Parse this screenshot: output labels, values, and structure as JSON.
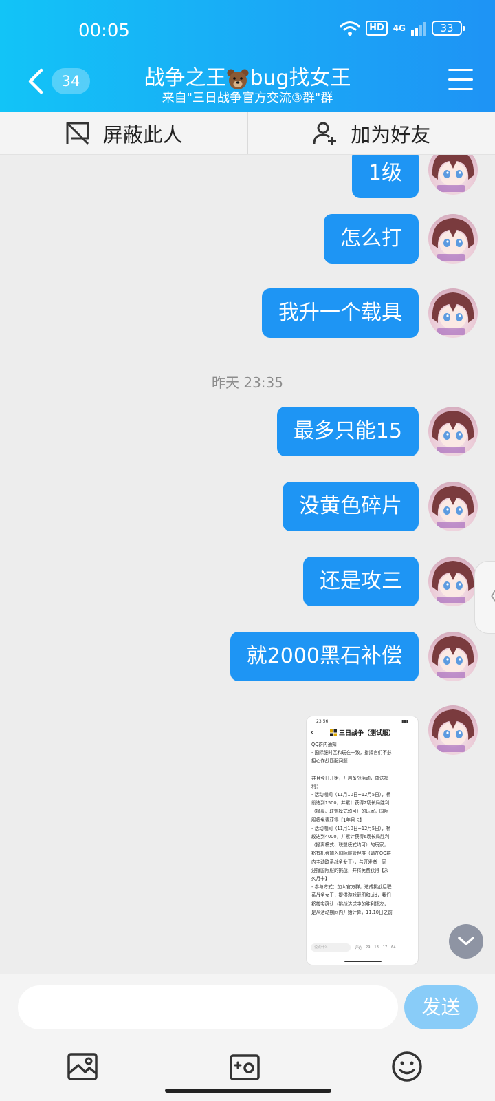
{
  "status_bar": {
    "time": "00:05",
    "hd": "HD",
    "network": "4G",
    "battery": "33"
  },
  "header": {
    "unread_count": "34",
    "title_part1": "战争之王",
    "title_part2": "bug找女王",
    "subtitle": "来自\"三日战争官方交流③群\"群"
  },
  "actions": {
    "block": "屏蔽此人",
    "add_friend": "加为好友"
  },
  "messages": [
    {
      "text": "1级"
    },
    {
      "text": "怎么打"
    },
    {
      "text": "我升一个载具"
    },
    {
      "text": "最多只能15"
    },
    {
      "text": "没黄色碎片"
    },
    {
      "text": "还是攻三"
    },
    {
      "text": "就2000黑石补偿"
    }
  ],
  "timestamp": "昨天 23:35",
  "image_message": {
    "status_time": "23:56",
    "title": "三日战争（测试服）",
    "lines": [
      "QQ群内通知",
      "- 国际服时区和玩在一致，指挥官们不必",
      "担心作战匹配问题",
      "",
      "并且今日开始，开启备战活动，放送福",
      "利：",
      "- 活动期间（11月10日~12月5日），杯",
      "段达到1500，并累计获得2场长局胜利",
      "（撤离、联盟模式均可）的玩家，国际",
      "服将免费获得【1年月卡】",
      "- 活动期间（11月10日~12月5日），杯",
      "段达到4000，并累计获得6场长局胜利",
      "（撤离模式、联盟模式均可）的玩家，",
      "将有机会加入国际服管理群（请在QQ群",
      "内主动联系战争女王），与开发者一同",
      "迎接国际服的挑战，并将免费获得【永",
      "久月卡】",
      "- 参与方式：加入官方群，达成挑战后联",
      "系战争女王，提供游戏截图和uid，我们",
      "将核实确认（挑战达成中的胜利场次，",
      "是从活动期间内开始计算，11.10日之前"
    ],
    "input_placeholder": "说点什么",
    "footer_counts": [
      "评论",
      "29",
      "18",
      "17",
      "64"
    ]
  },
  "input": {
    "placeholder": "",
    "send": "发送"
  }
}
